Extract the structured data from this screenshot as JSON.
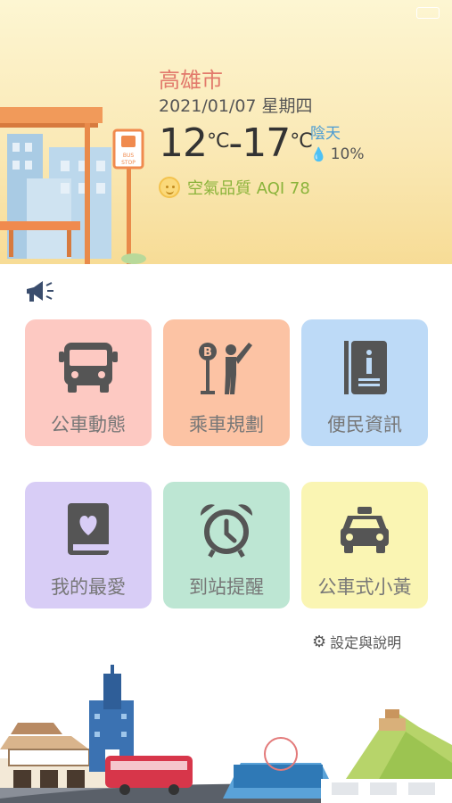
{
  "status_bar": {
    "left": "...",
    "time": "··:··"
  },
  "weather": {
    "city": "高雄市",
    "date": "2021/01/07 星期四",
    "temp_low": "12",
    "temp_high": "17",
    "unit": "°C",
    "dash": "-",
    "condition": "陰天",
    "rain_chance": "10%",
    "aqi_label": "空氣品質 AQI 78"
  },
  "bus_stop_sign": "BUS STOP",
  "menu": {
    "tiles": [
      {
        "label": "公車動態",
        "icon": "bus-icon",
        "color": "#fdc9c2"
      },
      {
        "label": "乘車規劃",
        "icon": "bus-stop-person-icon",
        "color": "#fcc3a4"
      },
      {
        "label": "便民資訊",
        "icon": "info-book-icon",
        "color": "#bddaf7"
      },
      {
        "label": "我的最愛",
        "icon": "favorite-book-icon",
        "color": "#d8cdf6"
      },
      {
        "label": "到站提醒",
        "icon": "alarm-clock-icon",
        "color": "#bde6d3"
      },
      {
        "label": "公車式小黃",
        "icon": "taxi-icon",
        "color": "#faf5b3"
      }
    ]
  },
  "settings_label": "設定與說明"
}
